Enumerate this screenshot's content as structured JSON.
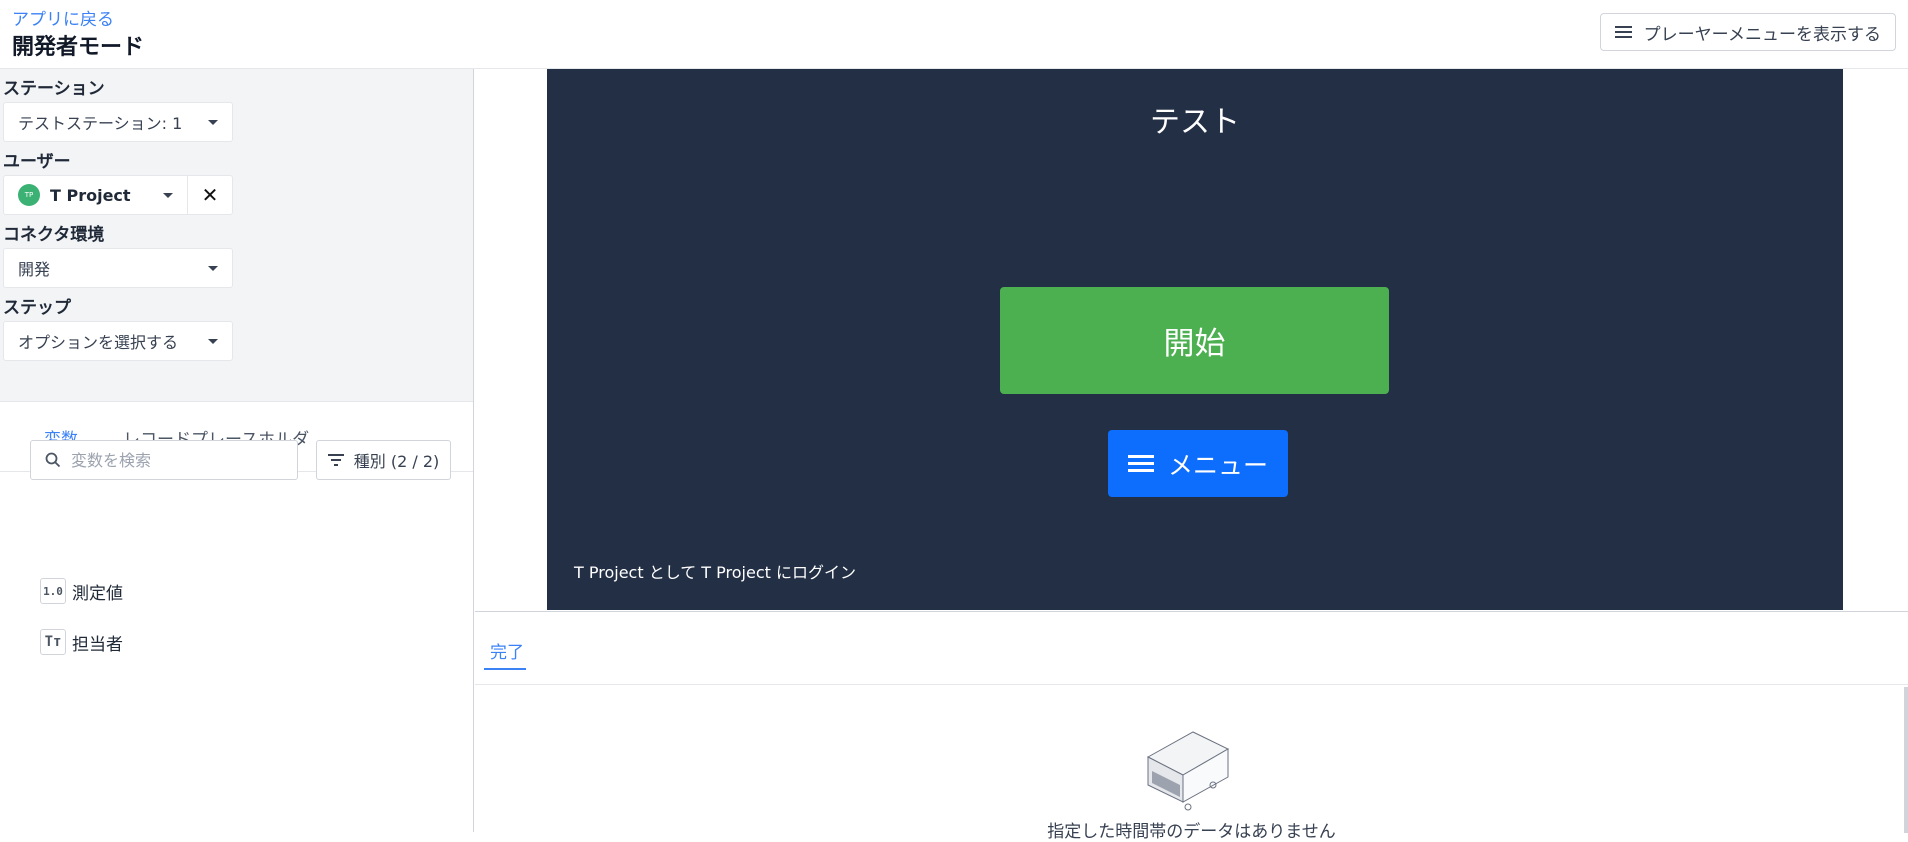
{
  "header": {
    "back_link": "アプリに戻る",
    "title": "開発者モード",
    "player_menu_label": "プレーヤーメニューを表示する"
  },
  "sidebar": {
    "station": {
      "label": "ステーション",
      "value": "テストステーション: 1"
    },
    "user": {
      "label": "ユーザー",
      "name": "T Project",
      "avatar_initials": "TP"
    },
    "connector": {
      "label": "コネクタ環境",
      "value": "開発"
    },
    "step": {
      "label": "ステップ",
      "value": "オプションを選択する"
    },
    "tabs": [
      {
        "label": "変数",
        "active": true
      },
      {
        "label": "レコードプレースホルダ",
        "active": false
      }
    ],
    "search": {
      "placeholder": "変数を検索",
      "value": ""
    },
    "filter_label": "種別 (2 / 2)",
    "variables": [
      {
        "icon_text": "1.0",
        "icon": "number-icon",
        "name": "測定値"
      },
      {
        "icon_text": "Tт",
        "icon": "text-type-icon",
        "name": "担当者"
      }
    ]
  },
  "preview": {
    "title": "テスト",
    "start_label": "開始",
    "menu_label": "メニュー",
    "login_text": "T Project として T Project にログイン"
  },
  "bottom": {
    "tab_label": "完了",
    "empty_text": "指定した時間帯のデータはありません"
  },
  "colors": {
    "accent": "#3b82f6",
    "preview_bg": "#222f45",
    "start_button": "#4caf50",
    "menu_button": "#0d6efd",
    "avatar": "#3bb273"
  }
}
